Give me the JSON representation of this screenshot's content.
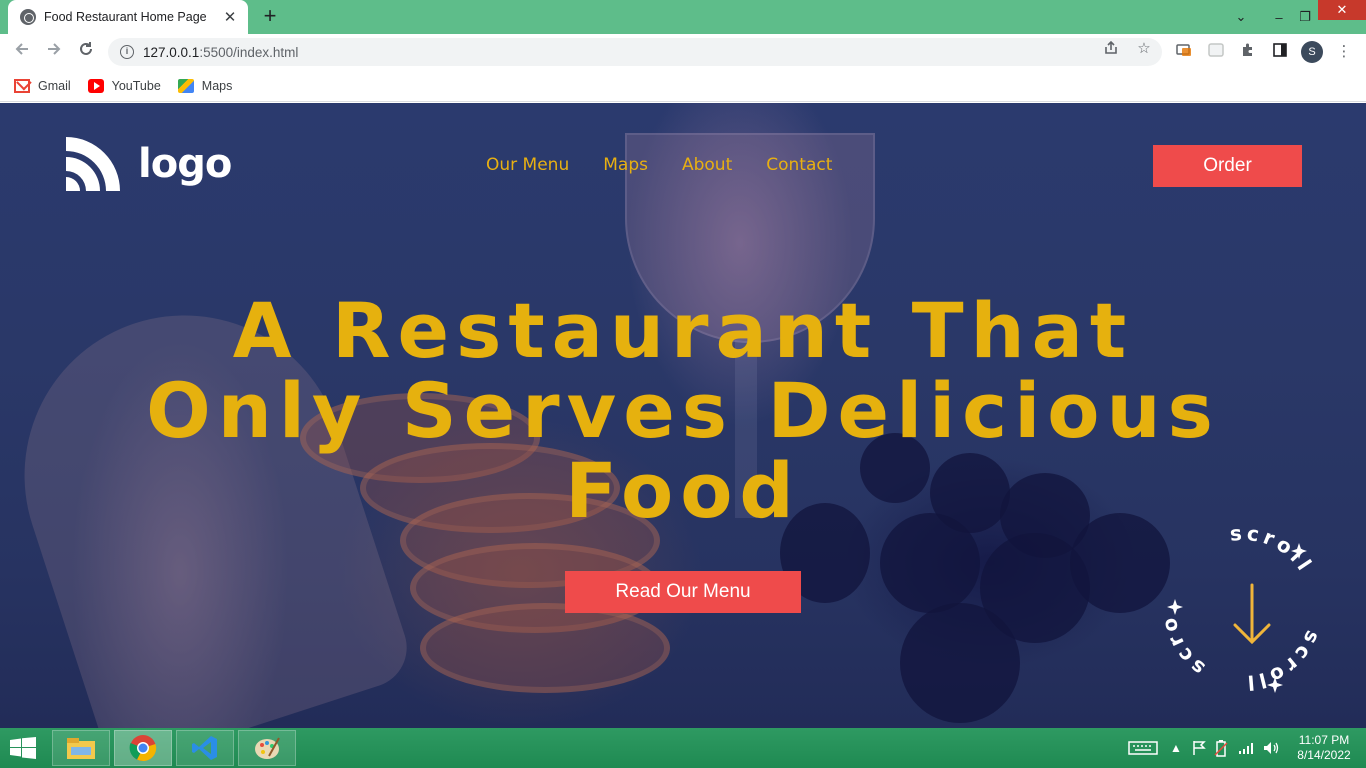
{
  "browser": {
    "tab_title": "Food Restaurant Home Page",
    "tab_close": "✕",
    "new_tab": "+",
    "url_host": "127.0.0.1",
    "url_rest": ":5500/index.html",
    "window_controls": {
      "dropdown": "⌄",
      "minimize": "–",
      "maximize": "❐",
      "close": "✕"
    }
  },
  "bookmarks": [
    {
      "label": "Gmail"
    },
    {
      "label": "YouTube"
    },
    {
      "label": "Maps"
    }
  ],
  "site": {
    "logo_text": "logo",
    "nav": [
      "Our Menu",
      "Maps",
      "About",
      "Contact"
    ],
    "order_label": "Order",
    "headline_lines": [
      "A Restaurant That",
      "Only Serves Delicious",
      "Food"
    ],
    "menu_button_label": "Read Our Menu",
    "scroll_label": "scroll",
    "colors": {
      "accent": "#e6b10e",
      "button": "#ef4b4b",
      "overlay": "#2a3868"
    }
  },
  "taskbar": {
    "time": "11:07 PM",
    "date": "8/14/2022"
  }
}
